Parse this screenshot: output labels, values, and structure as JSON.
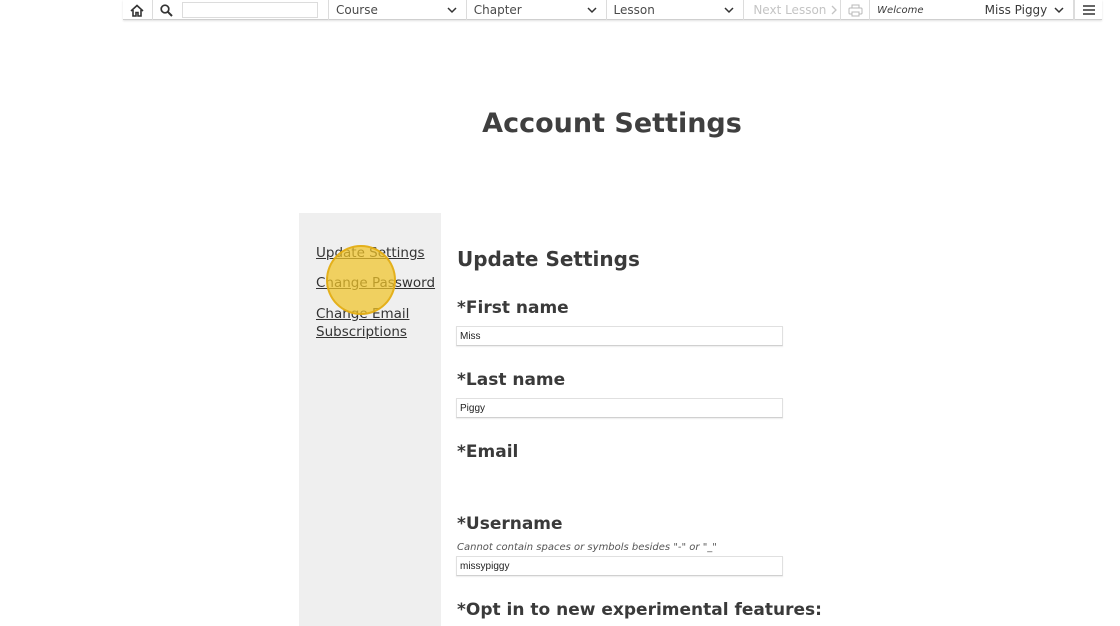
{
  "topbar": {
    "search_placeholder": "",
    "course_label": "Course",
    "chapter_label": "Chapter",
    "lesson_label": "Lesson",
    "next_lesson_label": "Next Lesson",
    "welcome_label": "Welcome",
    "user_name": "Miss Piggy"
  },
  "page": {
    "title": "Account Settings"
  },
  "sidebar": {
    "items": [
      {
        "label": "Update Settings"
      },
      {
        "label": "Change Password"
      },
      {
        "label": "Change Email Subscriptions"
      }
    ]
  },
  "form": {
    "section_title": "Update Settings",
    "first_name_label": "*First name",
    "first_name_value": "Miss",
    "last_name_label": "*Last name",
    "last_name_value": "Piggy",
    "email_label": "*Email",
    "username_label": "*Username",
    "username_hint": "Cannot contain spaces or symbols besides \"-\" or \"_\"",
    "username_value": "missypiggy",
    "opt_in_label": "*Opt in to new experimental features:"
  },
  "colors": {
    "click_highlight": "#f0c428",
    "sidebar_bg": "#efefef",
    "disabled_text": "#c4c4c4"
  }
}
